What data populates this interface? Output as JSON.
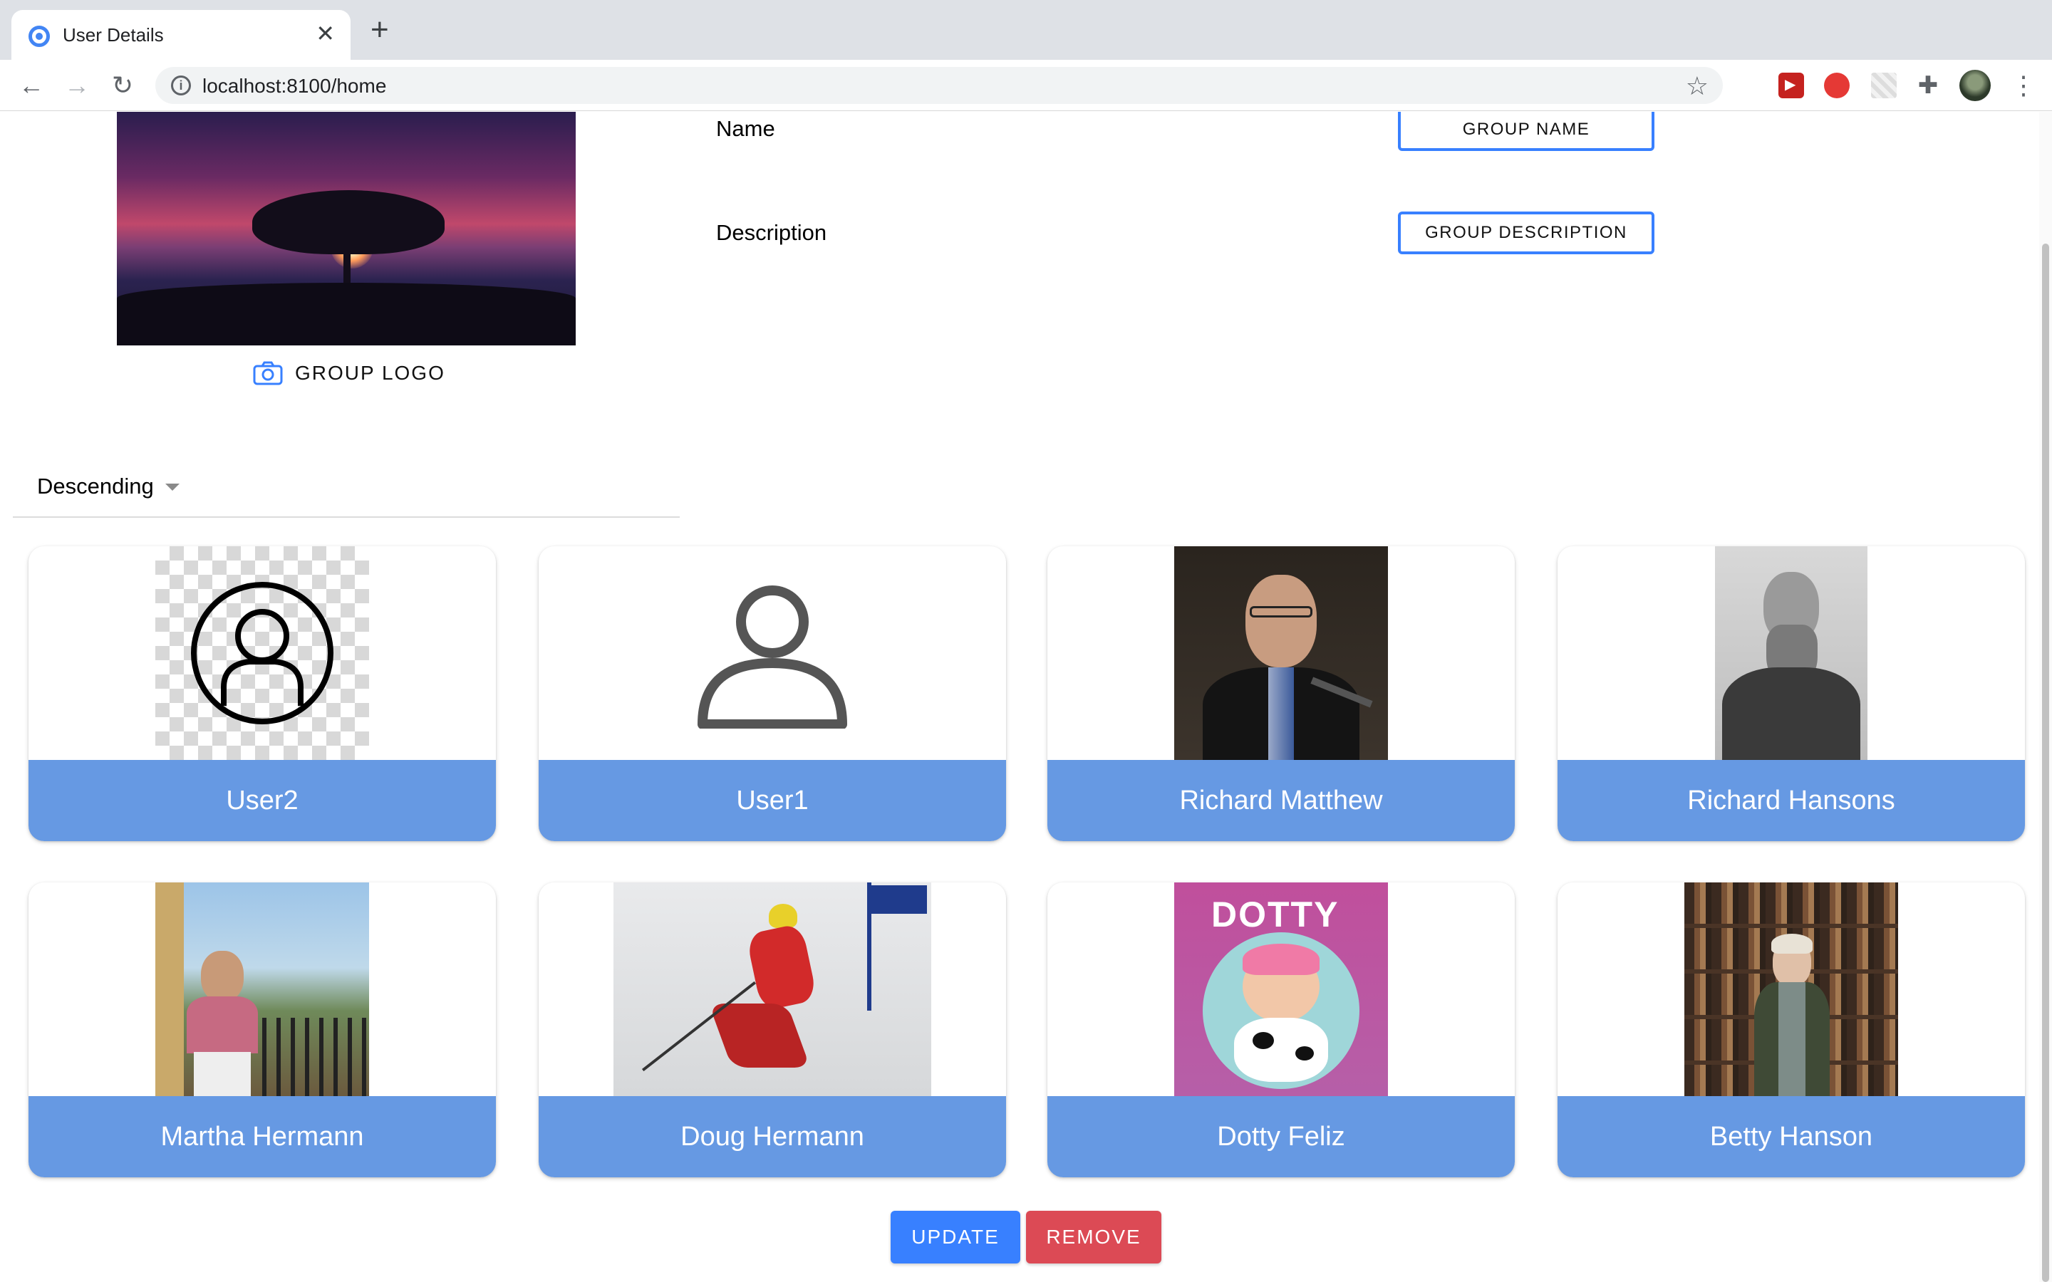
{
  "browser": {
    "tab_title": "User Details",
    "tab_close": "✕",
    "new_tab": "+",
    "url": "localhost:8100/home",
    "icons": [
      "back-arrow-icon",
      "forward-arrow-icon",
      "reload-icon",
      "site-info-icon",
      "bookmark-star-icon",
      "extension-icon",
      "profile-avatar",
      "more-menu-icon"
    ]
  },
  "group": {
    "logo_label": "GROUP LOGO",
    "name_label": "Name",
    "name_button": "GROUP NAME",
    "description_label": "Description",
    "description_button": "GROUP DESCRIPTION"
  },
  "sort": {
    "value": "Descending"
  },
  "users": [
    {
      "name": "User2",
      "image": "user-circle-placeholder-icon"
    },
    {
      "name": "User1",
      "image": "person-silhouette-icon"
    },
    {
      "name": "Richard Matthew",
      "image": "photo"
    },
    {
      "name": "Richard Hansons",
      "image": "photo"
    },
    {
      "name": "Martha Hermann",
      "image": "photo"
    },
    {
      "name": "Doug Hermann",
      "image": "photo"
    },
    {
      "name": "Dotty Feliz",
      "image": "photo"
    },
    {
      "name": "Betty Hanson",
      "image": "photo"
    }
  ],
  "dotty_title": "DOTTY",
  "actions": {
    "update": "UPDATE",
    "remove": "REMOVE"
  },
  "colors": {
    "accent": "#3880ff",
    "card_name_bg": "#6699e3",
    "danger": "#dc4a55"
  }
}
